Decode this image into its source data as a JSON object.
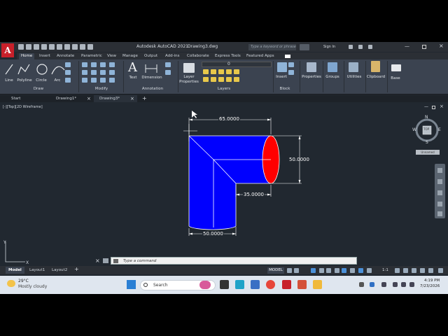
{
  "titlebar": {
    "app_logo": "A",
    "title": "Autodesk AutoCAD 2021",
    "filename": "Drawing3.dwg",
    "search_placeholder": "Type a keyword or phrase",
    "sign_in": "Sign In"
  },
  "ribbon_tabs": [
    "Home",
    "Insert",
    "Annotate",
    "Parametric",
    "View",
    "Manage",
    "Output",
    "Add-ins",
    "Collaborate",
    "Express Tools",
    "Featured Apps"
  ],
  "ribbon": {
    "draw_tools": [
      "Line",
      "Polyline",
      "Circle",
      "Arc"
    ],
    "text_tool": "Text",
    "dimension_tool": "Dimension",
    "layer_tool": "Layer Properties",
    "layer_value": "0",
    "insert_tool": "Insert",
    "properties_tool": "Properties",
    "groups_tool": "Groups",
    "utilities_tool": "Utilities",
    "clipboard_tool": "Clipboard",
    "base_tool": "Base",
    "panels": [
      "Draw",
      "Modify",
      "Annotation",
      "Layers",
      "Block"
    ]
  },
  "doc_tabs": [
    "Start",
    "Drawing1*",
    "Drawing3*"
  ],
  "viewport": {
    "label": "[-][Top][2D Wireframe]",
    "viewcube": {
      "top": "TOP",
      "n": "N",
      "s": "S",
      "e": "E",
      "w": "W",
      "ucs": "Unnamed"
    }
  },
  "drawing": {
    "dim_top": "65.0000",
    "dim_right": "50.0000",
    "dim_inner": "35.0000",
    "dim_bottom": "50.0000",
    "fill_color": "#0000ff",
    "end_color": "#ff0000"
  },
  "cmdline": {
    "placeholder": "Type a command"
  },
  "layout_tabs": [
    "Model",
    "Layout1",
    "Layout2"
  ],
  "status": {
    "model": "MODEL",
    "scale": "1:1"
  },
  "taskbar": {
    "weather_temp": "29°C",
    "weather_desc": "Mostly cloudy",
    "search": "Search",
    "time": "4:19 PM",
    "date": "7/23/2026"
  },
  "colors": {
    "autocad_red": "#c8202a"
  }
}
